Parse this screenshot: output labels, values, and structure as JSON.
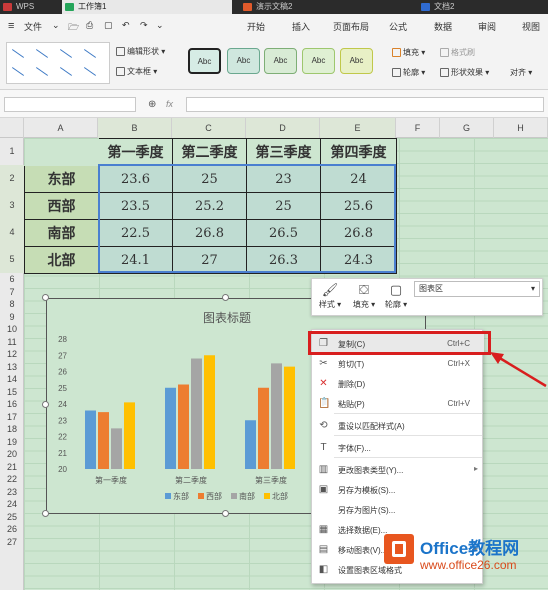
{
  "titlebar": {
    "wps": "WPS",
    "tabs": [
      {
        "label": "工作簿1",
        "color": "#25a55a"
      },
      {
        "label": "演示文稿2",
        "color": "#e05a2b"
      },
      {
        "label": "文档2",
        "color": "#2f6bd1"
      }
    ]
  },
  "ribbon": {
    "file_menu": "文件",
    "tabs": [
      "开始",
      "插入",
      "页面布局",
      "公式",
      "数据",
      "审阅",
      "视图"
    ],
    "edit_shape": "编辑形状",
    "textbox": "文本框",
    "style_box_label": "Abc",
    "fill": "填充",
    "outline": "轮廓",
    "format_painter": "格式刷",
    "shape_effects": "形状效果",
    "align": "对齐"
  },
  "formula": {
    "fx": "fx"
  },
  "columns": [
    "A",
    "B",
    "C",
    "D",
    "E",
    "F",
    "G",
    "H"
  ],
  "rows": [
    "1",
    "2",
    "3",
    "4",
    "5",
    "6",
    "7",
    "8",
    "9",
    "10",
    "11",
    "12",
    "13",
    "14",
    "15",
    "16",
    "17",
    "18",
    "19",
    "20",
    "21",
    "22",
    "23",
    "24",
    "25",
    "26",
    "27"
  ],
  "table": {
    "headers": [
      "第一季度",
      "第二季度",
      "第三季度",
      "第四季度"
    ],
    "rows": [
      {
        "label": "东部",
        "values": [
          "23.6",
          "25",
          "23",
          "24"
        ]
      },
      {
        "label": "西部",
        "values": [
          "23.5",
          "25.2",
          "25",
          "25.6"
        ]
      },
      {
        "label": "南部",
        "values": [
          "22.5",
          "26.8",
          "26.5",
          "26.8"
        ]
      },
      {
        "label": "北部",
        "values": [
          "24.1",
          "27",
          "26.3",
          "24.3"
        ]
      }
    ]
  },
  "chart_data": {
    "type": "bar",
    "title": "图表标题",
    "categories": [
      "第一季度",
      "第二季度",
      "第三季度"
    ],
    "series": [
      {
        "name": "东部",
        "values": [
          23.6,
          25,
          23
        ],
        "color": "#5b9bd5"
      },
      {
        "name": "西部",
        "values": [
          23.5,
          25.2,
          25
        ],
        "color": "#ed7d31"
      },
      {
        "name": "南部",
        "values": [
          22.5,
          26.8,
          26.5
        ],
        "color": "#a5a5a5"
      },
      {
        "name": "北部",
        "values": [
          24.1,
          27,
          26.3
        ],
        "color": "#ffc000"
      }
    ],
    "ylim": [
      20,
      28
    ],
    "yticks": [
      "20",
      "21",
      "22",
      "23",
      "24",
      "25",
      "26",
      "27",
      "28"
    ],
    "grid": false,
    "legend": "bottom"
  },
  "minitoolbar": {
    "style": "样式",
    "fill": "填充",
    "outline": "轮廓",
    "dropdown": "图表区"
  },
  "context_menu": {
    "items": [
      {
        "label": "复制(C)",
        "shortcut": "Ctrl+C",
        "icon": "copy-icon",
        "glyph": "❐"
      },
      {
        "label": "剪切(T)",
        "shortcut": "Ctrl+X",
        "icon": "scissors-icon",
        "glyph": "✂"
      },
      {
        "label": "删除(D)",
        "shortcut": "",
        "icon": "delete-icon",
        "glyph": "✕"
      },
      {
        "label": "粘贴(P)",
        "shortcut": "Ctrl+V",
        "icon": "paste-icon",
        "glyph": "📋"
      },
      {
        "label": "重设以匹配样式(A)",
        "shortcut": "",
        "icon": "reset-icon",
        "glyph": "⟲"
      },
      {
        "label": "字体(F)...",
        "shortcut": "",
        "icon": "font-icon",
        "glyph": "T"
      },
      {
        "label": "更改图表类型(Y)...",
        "shortcut": "",
        "icon": "chart-type-icon",
        "glyph": "▥"
      },
      {
        "label": "另存为模板(S)...",
        "shortcut": "",
        "icon": "template-icon",
        "glyph": "▣"
      },
      {
        "label": "另存为图片(S)...",
        "shortcut": "",
        "icon": "",
        "glyph": ""
      },
      {
        "label": "选择数据(E)...",
        "shortcut": "",
        "icon": "select-data-icon",
        "glyph": "▦"
      },
      {
        "label": "移动图表(V)...",
        "shortcut": "",
        "icon": "move-chart-icon",
        "glyph": "▤"
      },
      {
        "label": "设置图表区域格式",
        "shortcut": "",
        "icon": "format-area-icon",
        "glyph": "◧"
      }
    ]
  },
  "watermark": {
    "brand": "Office教程网",
    "url": "www.office26.com"
  }
}
